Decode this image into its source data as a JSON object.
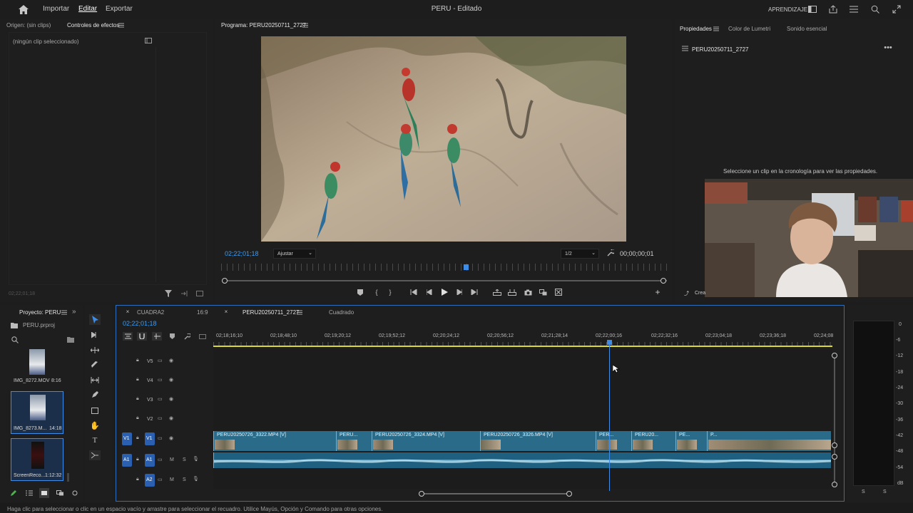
{
  "app": {
    "title": "PERU - Editado",
    "menus": [
      "Importar",
      "Editar",
      "Exportar"
    ],
    "workspace": "APRENDIZAJE"
  },
  "source_panel": {
    "tab_origin": "Origen: (sin clips)",
    "tab_effects": "Controles de efectos",
    "no_clip": "(ningún clip seleccionado)",
    "timecode": "02;22;01;18"
  },
  "program": {
    "title": "Programa: PERU20250711_2727",
    "timecode": "02;22;01;18",
    "fit": "Ajustar",
    "resolution": "1/2",
    "duration": "00;00;00;01"
  },
  "properties": {
    "tabs": [
      "Propiedades",
      "Color de Lumetri",
      "Sonido esencial"
    ],
    "sequence_name": "PERU20250711_2727",
    "hint": "Seleccione un clip en la cronología para ver las propiedades.",
    "create_label": "Crea"
  },
  "project": {
    "tab": "Proyecto: PERU",
    "file": "PERU.prproj",
    "items": [
      {
        "name": "IMG_8272.MOV",
        "duration": "8:16"
      },
      {
        "name": "IMG_8273.M...",
        "duration": "14:18"
      },
      {
        "name": "ScreenReco...",
        "duration": "1:12:32"
      }
    ]
  },
  "timeline": {
    "tabs": [
      "CUADRA2",
      "16:9",
      "PERU20250711_2727",
      "Cuadrado"
    ],
    "timecode": "02;22;01;18",
    "ruler": [
      "02;18;16;10",
      "02;18;48;10",
      "02;19;20;12",
      "02;19;52;12",
      "02;20;24;12",
      "02;20;56;12",
      "02;21;28;14",
      "02;22;00;16",
      "02;22;32;16",
      "02;23;04;18",
      "02;23;36;18",
      "02;24;08"
    ],
    "video_tracks": [
      "V5",
      "V4",
      "V3",
      "V2",
      "V1"
    ],
    "audio_tracks": [
      "A1",
      "A2"
    ],
    "source_v": "V1",
    "source_a": "A1",
    "mute_label": "M",
    "solo_label": "S",
    "clips": [
      "PERU20250726_3322.MP4 [V]",
      "PERU...",
      "PERU20250726_3324.MP4 [V]",
      "PERU20250726_3326.MP4 [V]",
      "PER...",
      "PERU20...",
      "PE...",
      "P..."
    ]
  },
  "meter": {
    "scale": [
      "0",
      "-6",
      "-12",
      "-18",
      "-24",
      "-30",
      "-36",
      "-42",
      "-48",
      "-54",
      "dB"
    ],
    "channels": [
      "S",
      "S"
    ]
  },
  "status": {
    "text": "Haga clic para seleccionar o clic en un espacio vacío y arrastre para seleccionar el recuadro. Utilice Mayús, Opción y Comando para otras opciones."
  },
  "colors": {
    "accent": "#2d8ceb",
    "clip_video": "#2a6b8a",
    "clip_audio": "#1f5f7f",
    "track_target": "#2b5fb0"
  }
}
